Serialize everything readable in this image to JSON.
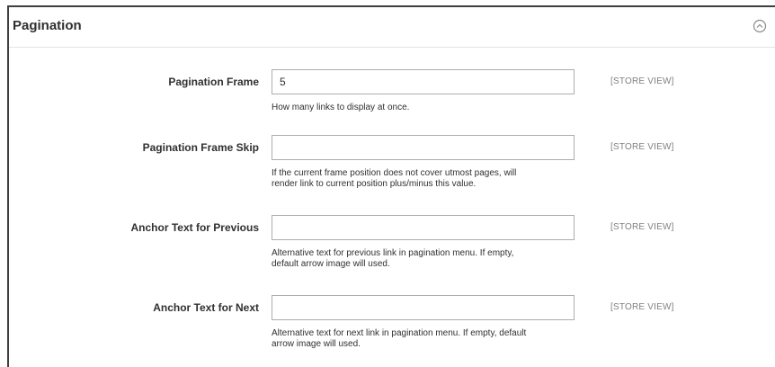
{
  "section": {
    "title": "Pagination"
  },
  "fields": [
    {
      "label": "Pagination Frame",
      "value": "5",
      "scope": "[STORE VIEW]",
      "note_lines": [
        "How many links to display at once."
      ]
    },
    {
      "label": "Pagination Frame Skip",
      "value": "",
      "scope": "[STORE VIEW]",
      "note_lines": [
        "If the current frame position does not cover utmost pages, will",
        "render link to current position plus/minus this value."
      ]
    },
    {
      "label": "Anchor Text for Previous",
      "value": "",
      "scope": "[STORE VIEW]",
      "note_lines": [
        "Alternative text for previous link in pagination menu. If empty,",
        "default arrow image will used."
      ]
    },
    {
      "label": "Anchor Text for Next",
      "value": "",
      "scope": "[STORE VIEW]",
      "note_lines": [
        "Alternative text for next link in pagination menu. If empty, default",
        "arrow image will used."
      ]
    }
  ],
  "icons": {
    "collapse": "chevron-up-circle-icon"
  }
}
